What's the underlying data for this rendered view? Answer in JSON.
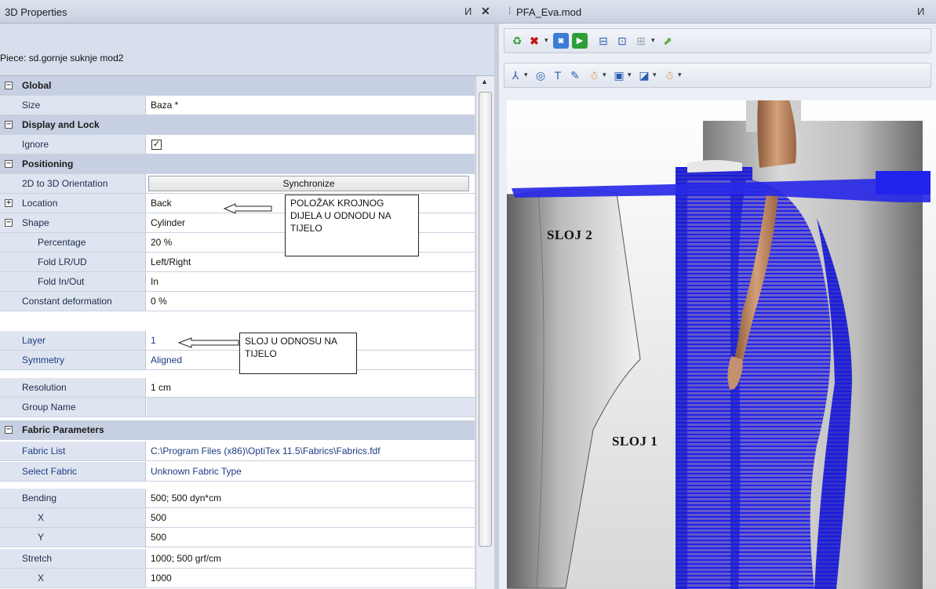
{
  "left_panel": {
    "title": "3D Properties",
    "pin_glyph": "И",
    "close_glyph": "✕",
    "piece_label": "Piece: sd.gornje suknje mod2"
  },
  "grid": {
    "global": {
      "label": "Global",
      "size_label": "Size",
      "size_value": "Baza *"
    },
    "display": {
      "label": "Display and Lock",
      "ignore_label": "Ignore",
      "ignore_checked": true
    },
    "positioning": {
      "label": "Positioning",
      "orientation_label": "2D to 3D Orientation",
      "synchronize_label": "Synchronize",
      "location_label": "Location",
      "location_value": "Back",
      "shape_label": "Shape",
      "shape_value": "Cylinder",
      "percentage_label": "Percentage",
      "percentage_value": "20 %",
      "fold_lrud_label": "Fold LR/UD",
      "fold_lrud_value": "Left/Right",
      "fold_inout_label": "Fold In/Out",
      "fold_inout_value": "In",
      "deformation_label": "Constant deformation",
      "deformation_value": "0 %",
      "layer_label": "Layer",
      "layer_value": "1",
      "symmetry_label": "Symmetry",
      "symmetry_value": "Aligned",
      "resolution_label": "Resolution",
      "resolution_value": "1 cm",
      "group_label": "Group Name",
      "group_value": ""
    },
    "fabric": {
      "label": "Fabric Parameters",
      "list_label": "Fabric List",
      "list_value": "C:\\Program Files (x86)\\OptiTex 11.5\\Fabrics\\Fabrics.fdf",
      "select_label": "Select Fabric",
      "select_value": "Unknown Fabric Type"
    },
    "bending": {
      "label": "Bending",
      "value": "500; 500 dyn*cm",
      "x_label": "X",
      "x_value": "500",
      "y_label": "Y",
      "y_value": "500"
    },
    "stretch": {
      "label": "Stretch",
      "value": "1000; 500 grf/cm",
      "x_label": "X",
      "x_value": "1000"
    }
  },
  "notes": {
    "location_note": [
      "POLOŽAK KROJNOG",
      "DIJELA U ODNODU NA",
      "TIJELO"
    ],
    "layer_note": [
      "SLOJ U ODNOSU NA",
      "TIJELO"
    ]
  },
  "viewport": {
    "title": "PFA_Eva.mod",
    "pin_glyph": "И",
    "layer2_label": "SLOJ 2",
    "layer1_label": "SLOJ 1"
  },
  "colors": {
    "fabric_blue": "#2222ee",
    "pane_header": "#c8d0e0",
    "category_bg": "#c7d0e2"
  }
}
